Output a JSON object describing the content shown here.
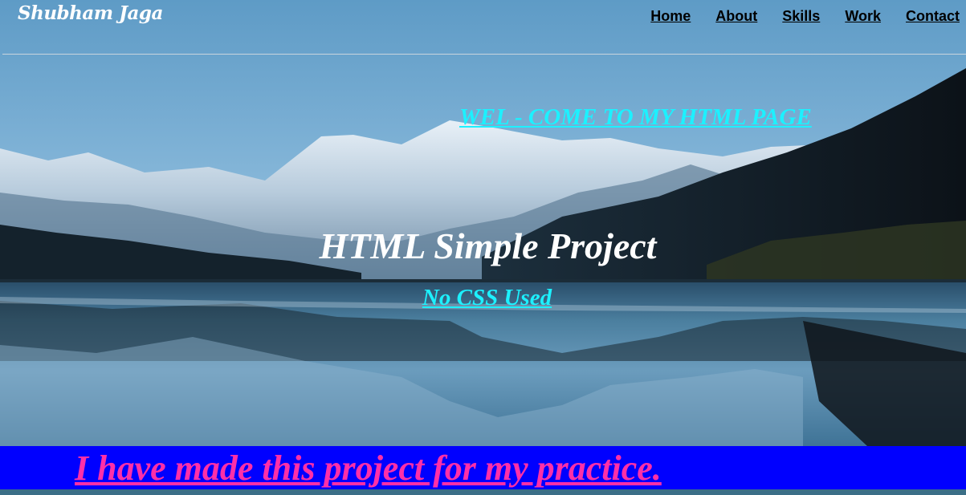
{
  "header": {
    "brand": "Shubham Jaga",
    "nav": [
      "Home",
      "About",
      "Skills",
      "Work",
      "Contact"
    ]
  },
  "hero": {
    "welcome": "WEL - COME TO MY HTML PAGE",
    "title": "HTML Simple Project",
    "subtitle": "No CSS Used"
  },
  "banner": {
    "text": "I have made this project for my practice."
  },
  "colors": {
    "accent_cyan": "#1cf1ff",
    "banner_blue": "#0000ff",
    "banner_text_pink": "#ff2fa8"
  }
}
